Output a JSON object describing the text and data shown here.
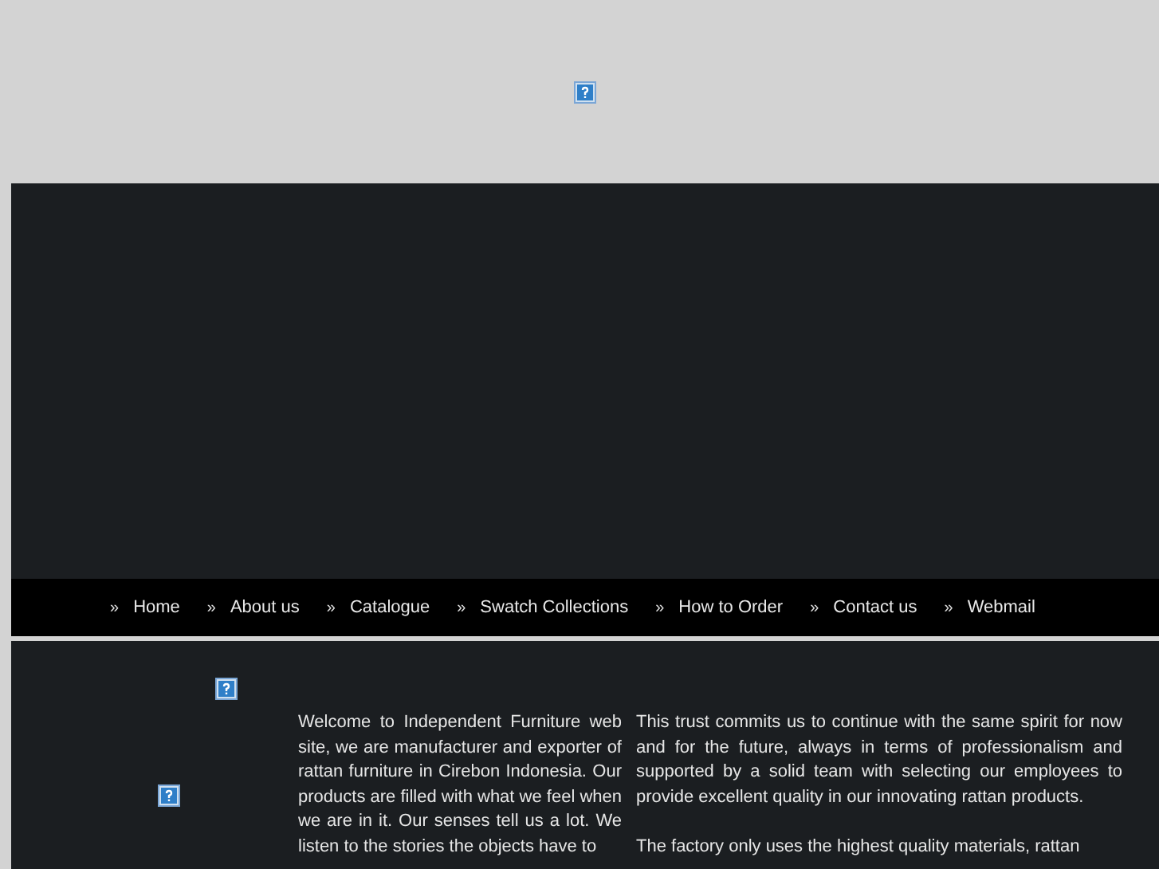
{
  "nav": [
    {
      "bullet": "»",
      "label": "Home"
    },
    {
      "bullet": "»",
      "label": "About us"
    },
    {
      "bullet": "»",
      "label": "Catalogue"
    },
    {
      "bullet": "»",
      "label": "Swatch Collections"
    },
    {
      "bullet": "»",
      "label": "How to Order"
    },
    {
      "bullet": "»",
      "label": "Contact us"
    },
    {
      "bullet": "»",
      "label": "Webmail"
    }
  ],
  "intro": [
    "Welcome to Independent Furniture web site, we are manufacturer and exporter of rattan furniture in Cirebon Indonesia. Our products are filled with what we feel when we are in it. Our senses tell us a lot. We listen to the stories the objects have to"
  ],
  "about": [
    "This trust commits us to continue with the same spirit for now and for the future, always in terms of professionalism and supported by a solid team with selecting our employees to provide excellent quality in our innovating rattan products.",
    "The factory only uses the highest quality materials, rattan"
  ]
}
